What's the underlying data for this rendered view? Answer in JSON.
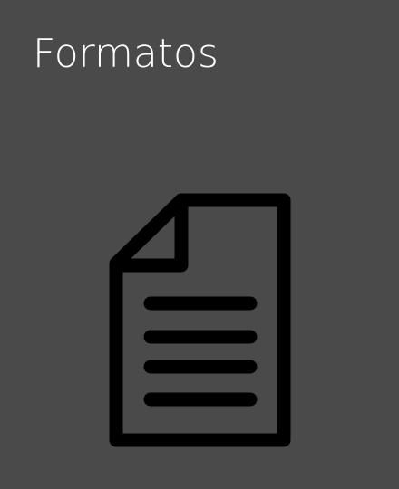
{
  "tile": {
    "title": "Formatos",
    "icon": "document-icon",
    "background_color": "#4a4a4a",
    "text_color": "#ffffff",
    "icon_color": "#000000"
  }
}
